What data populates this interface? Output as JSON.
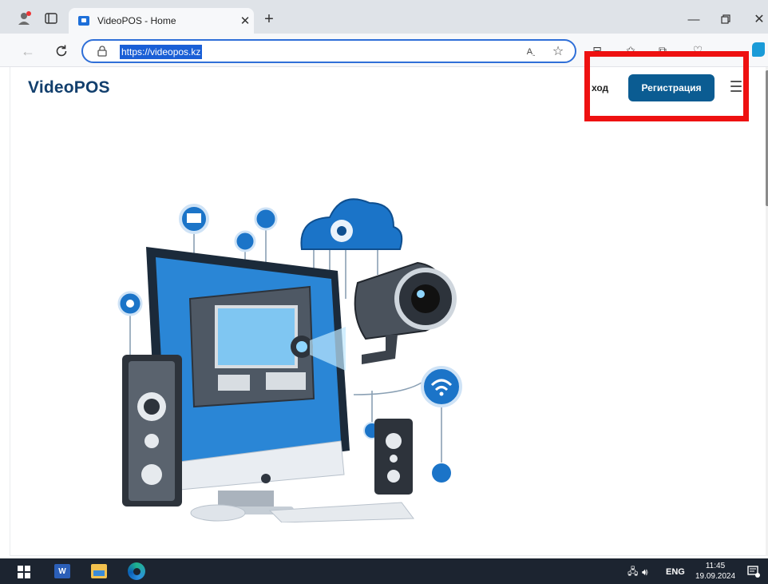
{
  "browser": {
    "tab_title": "VideoPOS - Home",
    "url": "https://videopos.kz",
    "icons": [
      "profile-icon",
      "tab-actions-icon",
      "favicon",
      "close-icon",
      "new-tab-icon",
      "minimize-icon",
      "restore-icon",
      "window-close-icon",
      "back-icon",
      "refresh-icon",
      "lock-icon",
      "read-aloud-icon",
      "favorite-star-icon",
      "split-screen-icon",
      "favorites-icon",
      "collections-icon",
      "browser-essentials-icon",
      "more-icon",
      "copilot-icon"
    ]
  },
  "page": {
    "logo": "VideoPOS",
    "login_link": "ход",
    "register_button": "Регистрация",
    "menu_icon": "hamburger-menu-icon",
    "hero_image": "video-surveillance-illustration"
  },
  "annotation": {
    "highlight_color": "#ee1111"
  },
  "taskbar": {
    "apps": [
      "windows-start-icon",
      "word-icon",
      "file-explorer-icon",
      "edge-icon"
    ],
    "language": "ENG",
    "time": "11:45",
    "date": "19.09.2024"
  },
  "colors": {
    "brand": "#123f6d",
    "button": "#0b5c92",
    "omnibox_border": "#2f6fd8"
  }
}
